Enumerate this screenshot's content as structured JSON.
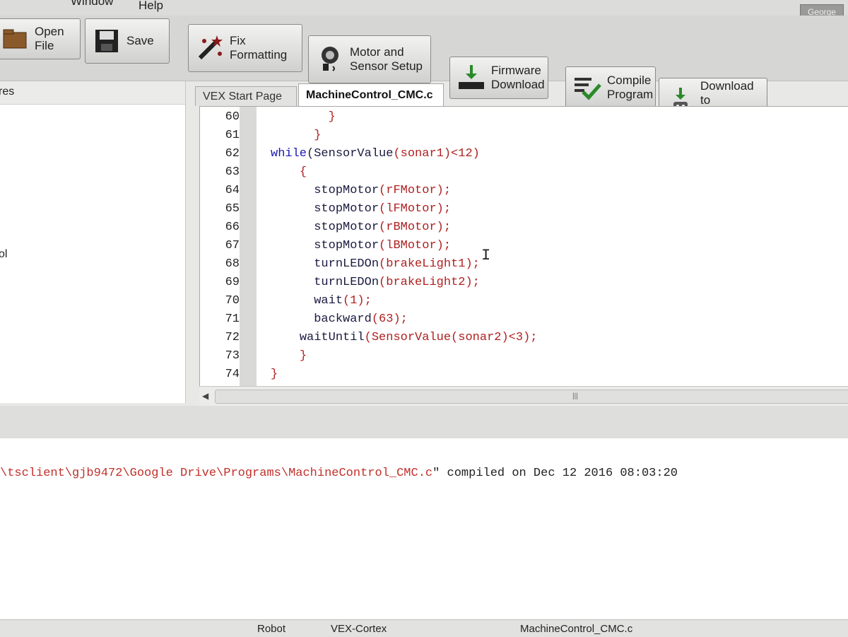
{
  "menubar": {
    "items": [
      "Window",
      "Help"
    ],
    "user": "George"
  },
  "toolbar": {
    "open_file": "Open File",
    "save": "Save",
    "fix_formatting": "Fix\nFormatting",
    "motor_sensor_setup": "Motor and\nSensor Setup",
    "firmware_download": "Firmware\nDownload",
    "compile_program": "Compile\nProgram",
    "download_to_robot": "Download to\nRobot"
  },
  "left_panel": {
    "header_fragment": "res",
    "item_fragment": "ol"
  },
  "tabs": [
    {
      "label": "VEX Start Page"
    },
    {
      "label": "MachineControl_CMC.c"
    }
  ],
  "code": {
    "line_numbers": [
      "60",
      "61",
      "62",
      "63",
      "64",
      "65",
      "66",
      "67",
      "68",
      "69",
      "70",
      "71",
      "72",
      "73",
      "74"
    ],
    "lines": [
      {
        "indent": "        ",
        "fn": "",
        "args": "}",
        "kw": ""
      },
      {
        "indent": "      ",
        "fn": "",
        "args": "}",
        "kw": ""
      },
      {
        "indent": "",
        "kw": "while",
        "fn": "(SensorValue",
        "args": "(sonar1)<12)"
      },
      {
        "indent": "    ",
        "fn": "",
        "args": "{",
        "kw": ""
      },
      {
        "indent": "      ",
        "fn": "stopMotor",
        "args": "(rFMotor);",
        "kw": ""
      },
      {
        "indent": "      ",
        "fn": "stopMotor",
        "args": "(lFMotor);",
        "kw": ""
      },
      {
        "indent": "      ",
        "fn": "stopMotor",
        "args": "(rBMotor);",
        "kw": ""
      },
      {
        "indent": "      ",
        "fn": "stopMotor",
        "args": "(lBMotor);",
        "kw": ""
      },
      {
        "indent": "      ",
        "fn": "turnLEDOn",
        "args": "(brakeLight1);",
        "kw": ""
      },
      {
        "indent": "      ",
        "fn": "turnLEDOn",
        "args": "(brakeLight2);",
        "kw": ""
      },
      {
        "indent": "      ",
        "fn": "wait",
        "args": "(1);",
        "kw": ""
      },
      {
        "indent": "      ",
        "fn": "backward",
        "args": "(63);",
        "kw": ""
      },
      {
        "indent": "    ",
        "fn": "waitUntil",
        "args": "(SensorValue(sonar2)<3);",
        "kw": ""
      },
      {
        "indent": "    ",
        "fn": "",
        "args": "}",
        "kw": ""
      },
      {
        "indent": "",
        "fn": "",
        "args": "}",
        "kw": ""
      }
    ]
  },
  "output": {
    "path": "\\tsclient\\gjb9472\\Google Drive\\Programs\\MachineControl_CMC.c",
    "rest": "\" compiled on Dec 12 2016 08:03:20"
  },
  "statusbar": {
    "robot": "Robot",
    "platform": "VEX-Cortex",
    "file": "MachineControl_CMC.c"
  }
}
